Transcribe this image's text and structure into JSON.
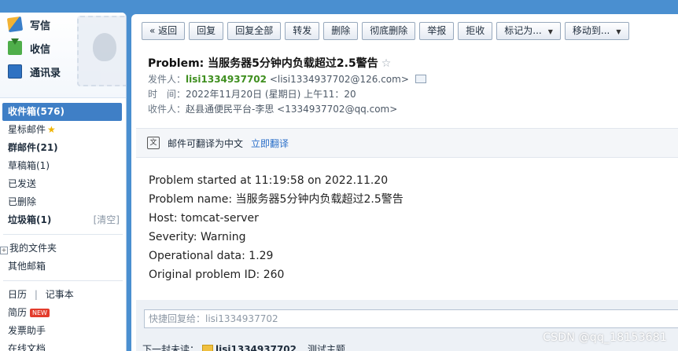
{
  "sidebar": {
    "quick": [
      {
        "label": "写信",
        "icon": "write-icon"
      },
      {
        "label": "收信",
        "icon": "inbox-icon"
      },
      {
        "label": "通讯录",
        "icon": "contacts-icon"
      }
    ],
    "folders": [
      {
        "label": "收件箱(576)"
      },
      {
        "label": "星标邮件"
      },
      {
        "label": "群邮件(21)"
      },
      {
        "label": "草稿箱(1)"
      },
      {
        "label": "已发送"
      },
      {
        "label": "已删除"
      },
      {
        "label": "垃圾箱(1)",
        "action": "[清空]"
      }
    ],
    "my_folders": "我的文件夹",
    "other_mailbox": "其他邮箱",
    "calendar": "日历",
    "separator": "|",
    "notebook": "记事本",
    "resume": "简历",
    "new_badge": "NEW",
    "sending_assistant": "发票助手",
    "online_docs": "在线文档"
  },
  "toolbar": {
    "back": "« 返回",
    "reply": "回复",
    "reply_all": "回复全部",
    "forward": "转发",
    "delete": "删除",
    "delete_permanently": "彻底删除",
    "report": "举报",
    "reject": "拒收",
    "mark_as": "标记为...",
    "move_to": "移动到...",
    "caret": "▼"
  },
  "email": {
    "subject": "Problem: 当服务器5分钟内负载超过2.5警告",
    "star": "☆",
    "from_label": "发件人：",
    "from_name": "lisi1334937702",
    "from_addr": "<lisi1334937702@126.com>",
    "time_label": "时　间：",
    "time_value": "2022年11月20日 (星期日) 上午11：20",
    "to_label": "收件人：",
    "to_value": "赵县通便民平台-李思 <1334937702@qq.com>",
    "translate_text": "邮件可翻译为中文",
    "translate_link": "立即翻译",
    "translate_icon": "文",
    "body": [
      "Problem started at 11:19:58 on 2022.11.20",
      "Problem name: 当服务器5分钟内负载超过2.5警告",
      "Host: tomcat-server",
      "Severity: Warning",
      "Operational data: 1.29",
      "Original problem ID: 260"
    ]
  },
  "reply": {
    "placeholder": "快捷回复给：lisi1334937702",
    "next_label": "下一封未读：",
    "next_sender": "lisi1334937702",
    "next_subject": "测试主题"
  },
  "watermark": "CSDN @qq_18153681",
  "colors": {
    "active_folder": "#3f7fc6",
    "sender_name": "#3f8f1f",
    "link": "#2a6fc9",
    "page_background": "#4a8fd0"
  }
}
